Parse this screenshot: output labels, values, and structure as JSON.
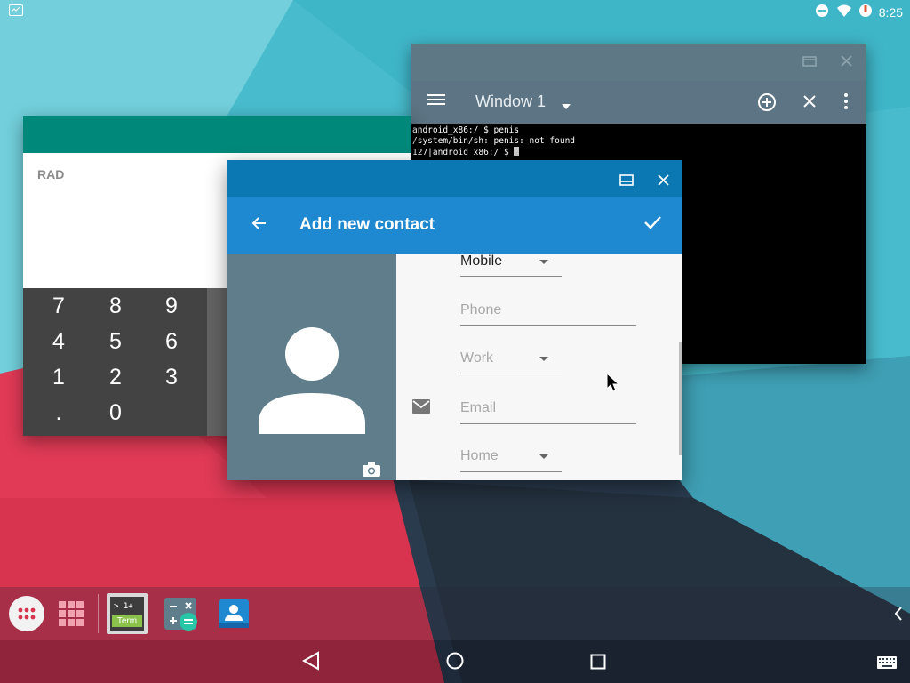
{
  "status_bar": {
    "time": "8:25",
    "icons": [
      "screenshot-icon",
      "dnd-icon",
      "wifi-icon",
      "battery-icon"
    ]
  },
  "terminal": {
    "window_title": "Window 1",
    "lines": [
      "android_x86:/ $ penis",
      "/system/bin/sh: penis: not found",
      "127|android_x86:/ $ "
    ],
    "colors": {
      "titlebar": "#5f7886",
      "toolbar": "#5c7483",
      "background": "#000000"
    }
  },
  "calculator": {
    "mode": "RAD",
    "keys": [
      [
        "7",
        "8",
        "9"
      ],
      [
        "4",
        "5",
        "6"
      ],
      [
        "1",
        "2",
        "3"
      ],
      [
        ".",
        "0",
        ""
      ]
    ],
    "colors": {
      "titlebar": "#00897b",
      "pad": "#434343"
    }
  },
  "contacts": {
    "title": "Add new contact",
    "phone_type": "Mobile",
    "phone_placeholder": "Phone",
    "email_type_placeholder": "Work",
    "email_placeholder": "Email",
    "address_type_placeholder": "Home",
    "colors": {
      "titlebar": "#0b78b4",
      "appbar": "#1e88d0",
      "photo_bg": "#607d8b"
    }
  },
  "taskbar": {
    "apps": [
      "app-drawer",
      "recents-grid",
      "terminal-emulator",
      "calculator",
      "contacts"
    ],
    "terminal_icon_text": "> 1+",
    "terminal_icon_label": "Term"
  },
  "navigation": [
    "back",
    "home",
    "overview",
    "keyboard"
  ]
}
